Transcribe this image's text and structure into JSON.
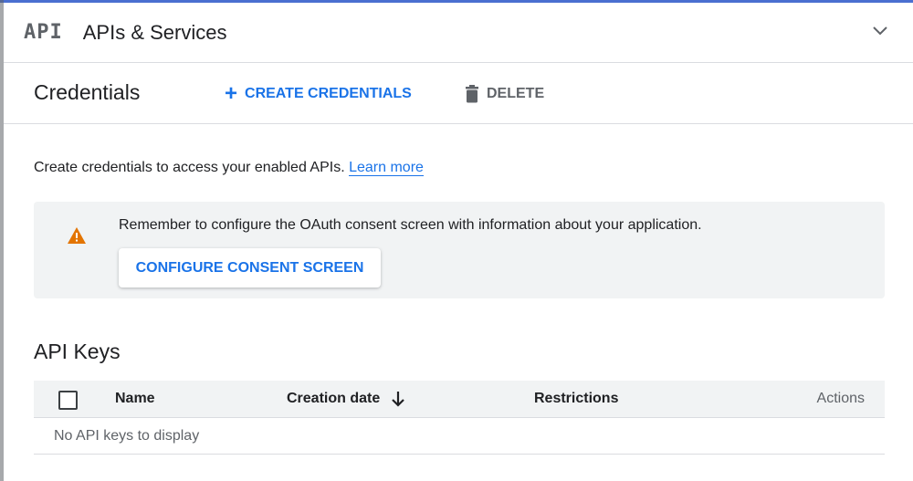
{
  "header": {
    "logo": "API",
    "title": "APIs & Services"
  },
  "toolbar": {
    "title": "Credentials",
    "create_label": "CREATE CREDENTIALS",
    "delete_label": "DELETE"
  },
  "intro": {
    "text": "Create credentials to access your enabled APIs.",
    "link": "Learn more"
  },
  "banner": {
    "message": "Remember to configure the OAuth consent screen with information about your application.",
    "button": "CONFIGURE CONSENT SCREEN"
  },
  "api_keys": {
    "title": "API Keys",
    "columns": [
      "Name",
      "Creation date",
      "Restrictions",
      "Actions"
    ],
    "empty_message": "No API keys to display"
  },
  "icons": {
    "header_logo": "api-logo-icon",
    "collapse": "chevron-down-icon",
    "create": "plus-icon",
    "delete": "trash-icon",
    "warning": "warning-icon",
    "sort": "arrow-down-icon"
  },
  "colors": {
    "accent": "#1a73e8",
    "warning": "#e37400",
    "muted": "#5f6368",
    "banner_bg": "#f1f3f4"
  }
}
